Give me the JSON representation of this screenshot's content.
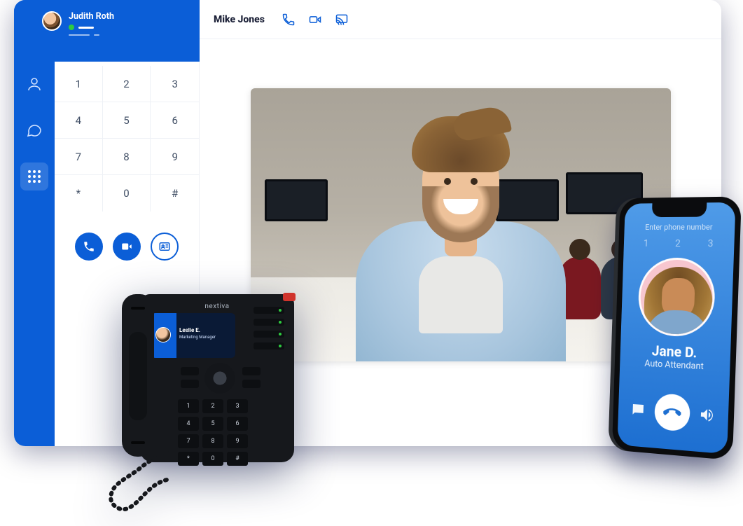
{
  "user": {
    "name": "Judith Roth"
  },
  "sidebar": {
    "icons": [
      "contacts-icon",
      "chat-icon",
      "dialpad-icon"
    ]
  },
  "dialpad": {
    "keys": [
      "1",
      "2",
      "3",
      "4",
      "5",
      "6",
      "7",
      "8",
      "9",
      "*",
      "0",
      "#"
    ]
  },
  "topbar": {
    "contact_name": "Mike Jones"
  },
  "deskphone": {
    "brand": "nextiva",
    "screen": {
      "name": "Leslie E.",
      "role": "Marketing Manager"
    },
    "keys": [
      "1",
      "2",
      "3",
      "4",
      "5",
      "6",
      "7",
      "8",
      "9",
      "*",
      "0",
      "#"
    ]
  },
  "smartphone": {
    "placeholder": "Enter phone number",
    "row_digits": [
      "1",
      "2",
      "3"
    ],
    "caller_name": "Jane D.",
    "caller_role": "Auto Attendant"
  }
}
